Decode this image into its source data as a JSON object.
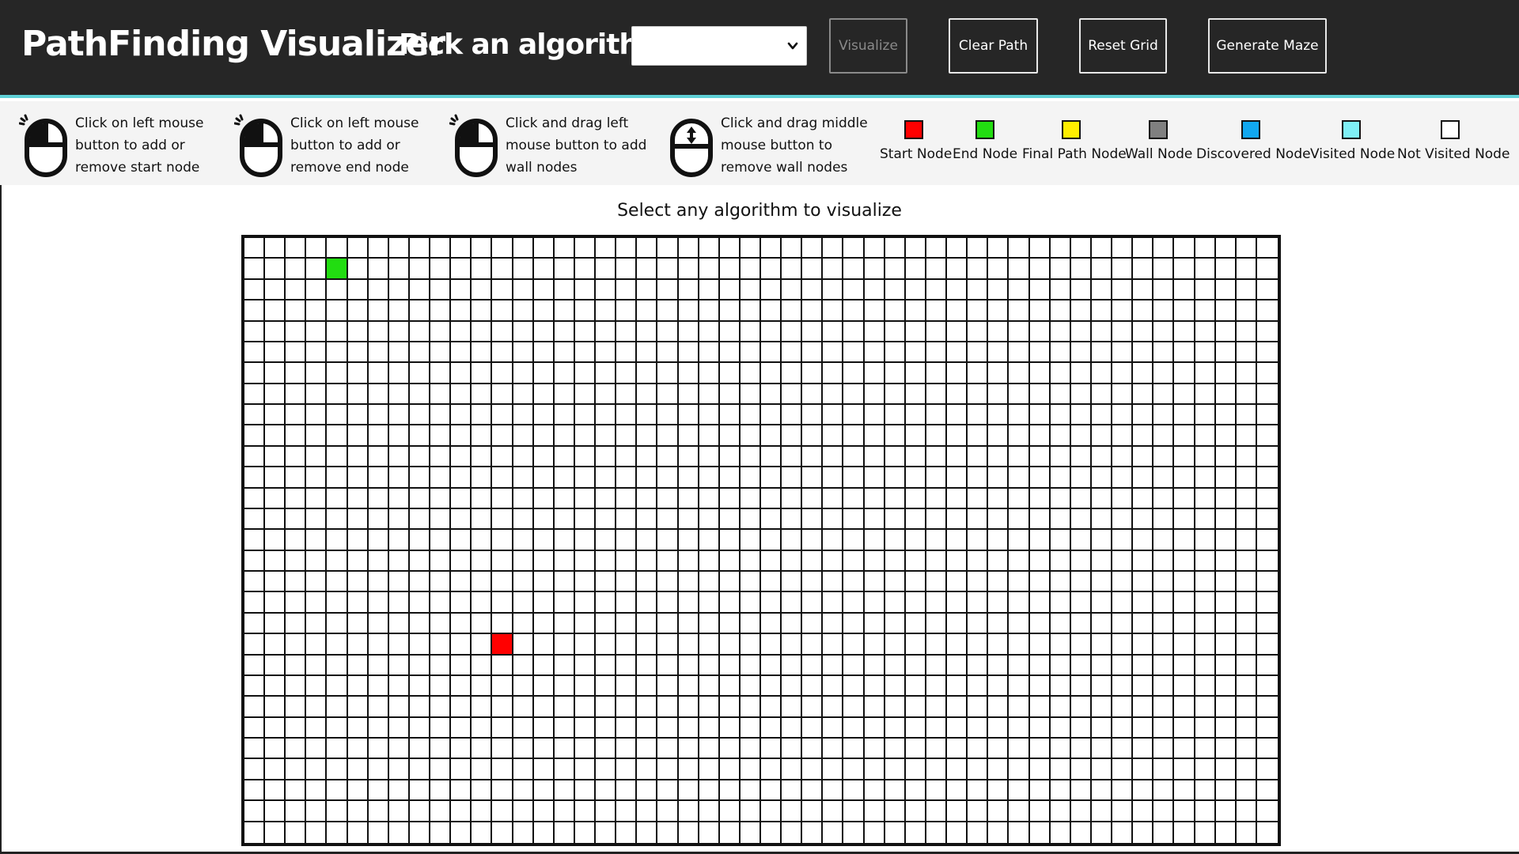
{
  "app": {
    "title": "PathFinding Visualizer",
    "pick_label": "Pick an algorithm :"
  },
  "algorithm_select": {
    "selected": "",
    "icon": "chevron-down-icon"
  },
  "buttons": {
    "visualize": "Visualize",
    "clear_path": "Clear Path",
    "reset_grid": "Reset Grid",
    "generate_maze": "Generate Maze"
  },
  "instructions": [
    {
      "text": "Click on left mouse button to add or remove start node",
      "icon": "mouse-left-click-icon"
    },
    {
      "text": "Click on left mouse button to add or remove end node",
      "icon": "mouse-left-click-icon"
    },
    {
      "text": "Click and drag left mouse button to add wall nodes",
      "icon": "mouse-left-click-icon"
    },
    {
      "text": "Click and drag middle mouse button to remove wall nodes",
      "icon": "mouse-middle-scroll-icon"
    }
  ],
  "legend": [
    {
      "label": "Start Node",
      "color": "#ff0000"
    },
    {
      "label": "End Node",
      "color": "#22dd11"
    },
    {
      "label": "Final Path Node",
      "color": "#ffee00"
    },
    {
      "label": "Wall Node",
      "color": "#808080"
    },
    {
      "label": "Discovered Node",
      "color": "#11a8f0"
    },
    {
      "label": "Visited Node",
      "color": "#7ff0f6"
    },
    {
      "label": "Not Visited Node",
      "color": "#ffffff"
    }
  ],
  "status": "Select any algorithm to visualize",
  "grid": {
    "rows": 29,
    "cols": 50,
    "start": {
      "row": 19,
      "col": 12
    },
    "end": {
      "row": 1,
      "col": 4
    }
  },
  "colors": {
    "header_bg": "#262626",
    "accent": "#5fd0d6",
    "legend_bg": "#f4f4f4"
  }
}
